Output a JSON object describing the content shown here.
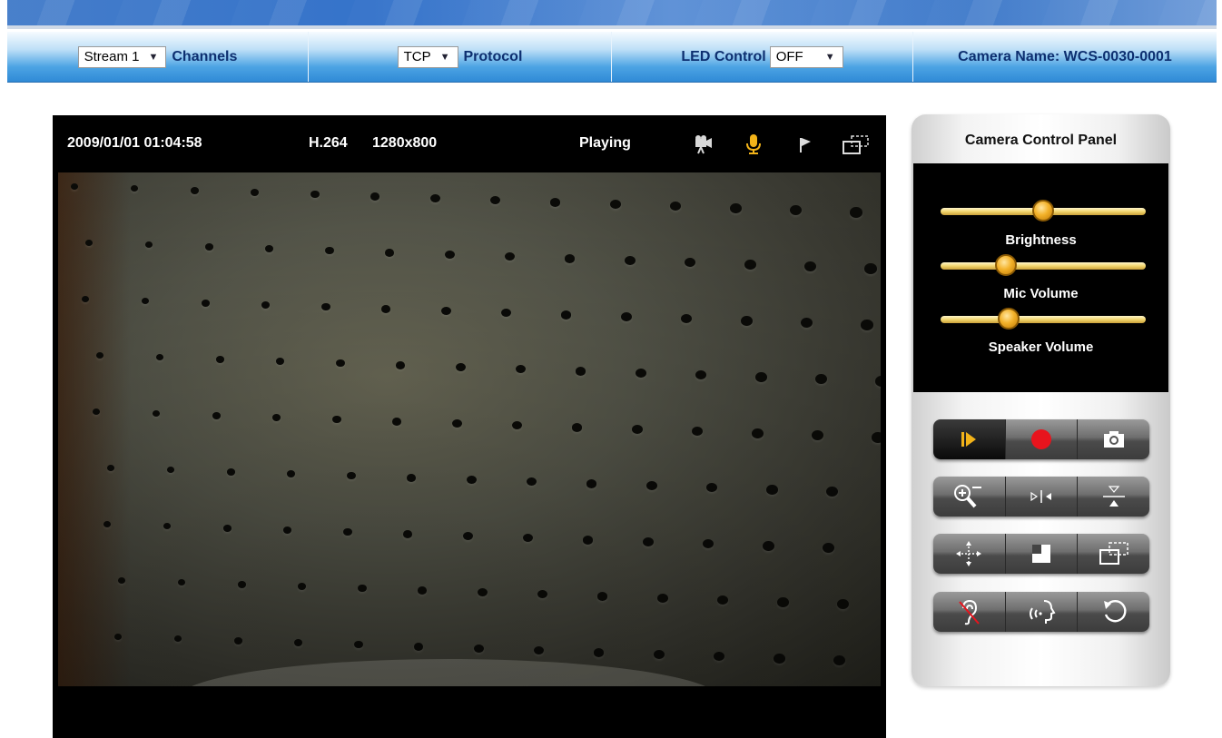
{
  "toolbar": {
    "stream_select": {
      "value": "Stream 1"
    },
    "channels_label": "Channels",
    "protocol_select": {
      "value": "TCP"
    },
    "protocol_label": "Protocol",
    "led_label": "LED Control",
    "led_select": {
      "value": "OFF"
    },
    "camera_name": "Camera Name: WCS-0030-0001"
  },
  "video": {
    "datetime": "2009/01/01  01:04:58",
    "codec": "H.264",
    "resolution": "1280x800",
    "status": "Playing",
    "icons": [
      "video-camera-icon",
      "microphone-icon",
      "flag-icon",
      "window-icon"
    ],
    "accent_color": "#f2b319"
  },
  "control_panel": {
    "title": "Camera Control Panel",
    "sliders": [
      {
        "label": "Brightness",
        "level": 0.5
      },
      {
        "label": "Mic Volume",
        "level": 0.32
      },
      {
        "label": "Speaker Volume",
        "level": 0.33
      }
    ],
    "button_rows": [
      [
        "play-icon",
        "record-icon",
        "snapshot-icon"
      ],
      [
        "zoom-icon",
        "mirror-horizontal-icon",
        "flip-vertical-icon"
      ],
      [
        "move-icon",
        "digital-zoom-area-icon",
        "window-icon"
      ],
      [
        "listen-mute-icon",
        "talk-icon",
        "rotate-icon"
      ]
    ],
    "record_color": "#e8141d"
  }
}
